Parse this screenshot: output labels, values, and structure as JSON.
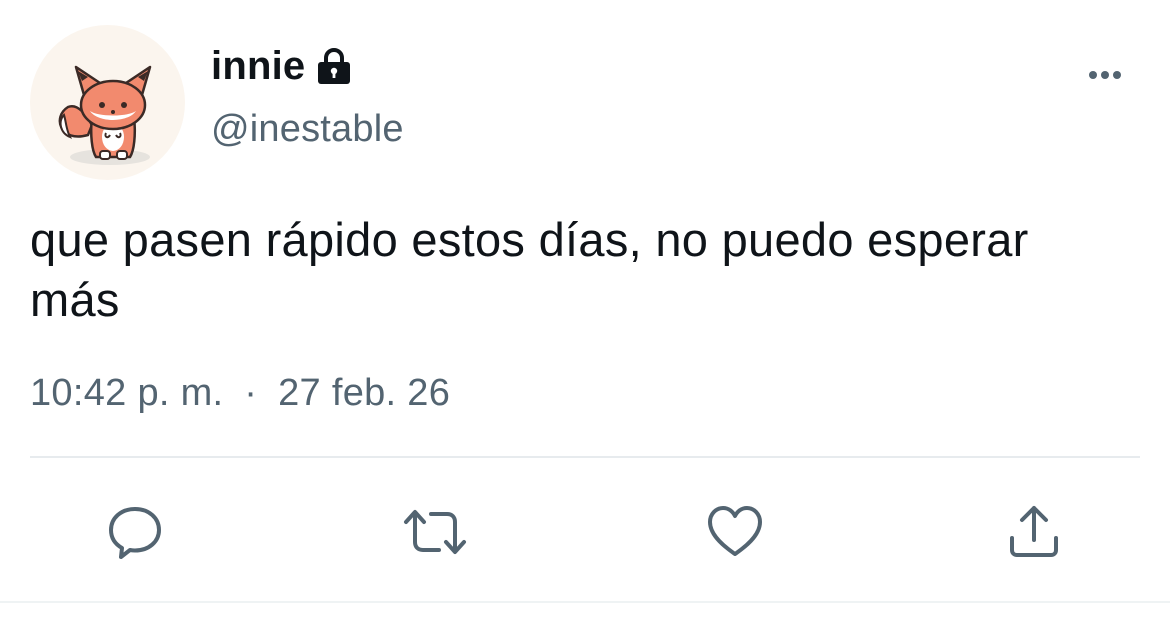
{
  "user": {
    "display_name": "innie",
    "handle": "@inestable",
    "protected": true,
    "avatar_icon": "fox-avatar-icon"
  },
  "tweet": {
    "text": "que pasen rápido estos días, no puedo esperar más",
    "time": "10:42 p. m.",
    "separator": "·",
    "date": "27 feb. 26"
  },
  "actions": {
    "reply_icon": "reply-icon",
    "retweet_icon": "retweet-icon",
    "like_icon": "heart-icon",
    "share_icon": "share-icon"
  },
  "colors": {
    "text_primary": "#0f1419",
    "text_secondary": "#536471",
    "icon_gray": "#536471",
    "divider": "#e7ebee",
    "fox_orange": "#f28a6e"
  }
}
